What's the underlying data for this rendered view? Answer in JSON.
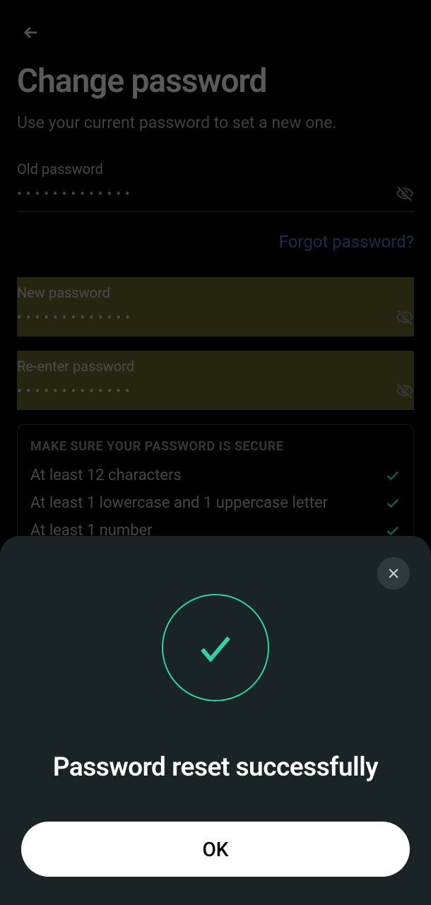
{
  "header": {
    "title": "Change password",
    "subtitle": "Use your current password to set a new one."
  },
  "fields": {
    "old": {
      "label": "Old password",
      "masked": "•••••••••••••"
    },
    "new": {
      "label": "New password",
      "masked": "•••••••••••••"
    },
    "reenter": {
      "label": "Re-enter password",
      "masked": "•••••••••••••"
    }
  },
  "forgot_link": "Forgot password?",
  "rules": {
    "title": "MAKE SURE YOUR PASSWORD IS SECURE",
    "items": [
      "At least 12 characters",
      "At least 1 lowercase and 1 uppercase letter",
      "At least 1 number"
    ]
  },
  "modal": {
    "title": "Password reset successfully",
    "ok": "OK"
  }
}
